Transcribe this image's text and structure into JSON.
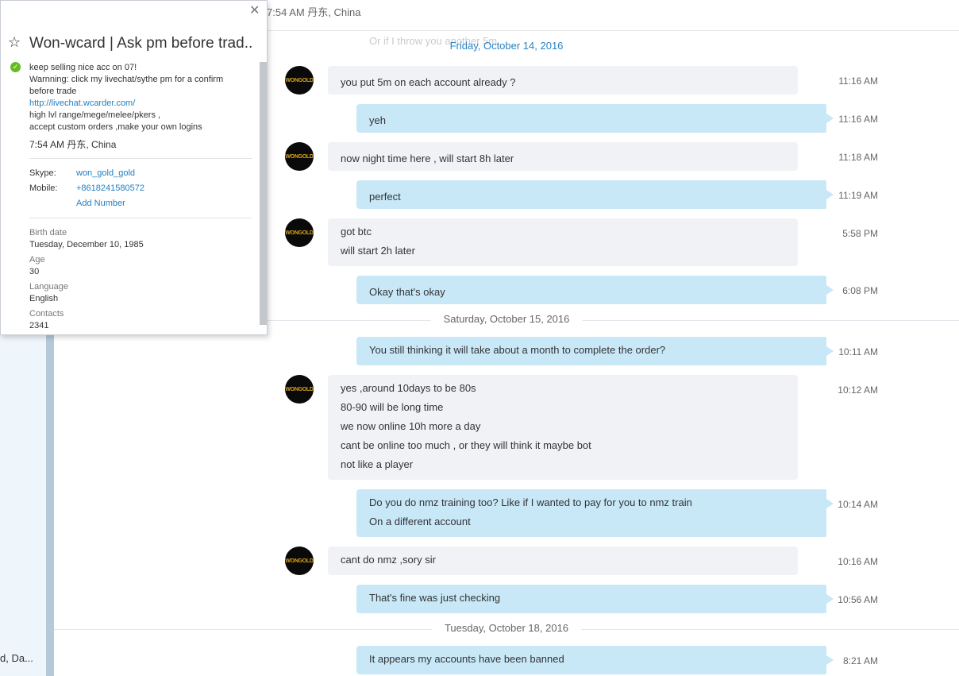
{
  "sidebar": {
    "truncated_text": "d, Da..."
  },
  "header": {
    "location": "7:54 AM 丹东, China"
  },
  "ghost_message": "Or if I throw you another 5m",
  "date_separators": [
    "Friday, October 14, 2016",
    "Saturday, October 15, 2016",
    "Tuesday, October 18, 2016"
  ],
  "avatar_text": "WONGOLD",
  "messages": [
    {
      "dir": "in",
      "lines": [
        "you put 5m on each account already  ?"
      ],
      "time": "11:16 AM"
    },
    {
      "dir": "out",
      "lines": [
        "yeh"
      ],
      "time": "11:16 AM"
    },
    {
      "dir": "in",
      "lines": [
        "now night time here , will start 8h later"
      ],
      "time": "11:18 AM"
    },
    {
      "dir": "out",
      "lines": [
        "perfect"
      ],
      "time": "11:19 AM"
    },
    {
      "dir": "in",
      "lines": [
        "got btc",
        "will start 2h later"
      ],
      "time": "5:58 PM"
    },
    {
      "dir": "out",
      "lines": [
        "Okay that's okay"
      ],
      "time": "6:08 PM"
    },
    {
      "dir": "out",
      "lines": [
        "You still thinking it will take about a month to complete the order?"
      ],
      "time": "10:11 AM"
    },
    {
      "dir": "in",
      "lines": [
        "yes  ,around 10days to be 80s",
        "80-90 will be long time",
        "we now online 10h more a day",
        "cant be online too much , or they will think it maybe bot",
        "not like a player"
      ],
      "time": "10:12 AM"
    },
    {
      "dir": "out",
      "lines": [
        "Do you do nmz training too? Like if I wanted to pay for you to nmz train",
        "On a different account"
      ],
      "time": "10:14 AM"
    },
    {
      "dir": "in",
      "lines": [
        "cant do nmz ,sory sir"
      ],
      "time": "10:16 AM"
    },
    {
      "dir": "out",
      "lines": [
        "That's fine was just checking"
      ],
      "time": "10:56 AM"
    },
    {
      "dir": "out",
      "lines": [
        "It appears my accounts have been banned"
      ],
      "time": "8:21 AM"
    }
  ],
  "profile": {
    "title": "Won-wcard | Ask pm before trad...",
    "status": "online",
    "mood_lines": [
      "keep selling nice acc on 07!",
      "Warnning: click my livechat/sythe pm for a confirm",
      "before trade",
      "http://livechat.wcarder.com/",
      "high lvl range/mege/melee/pkers ,",
      "accept custom orders ,make your own logins"
    ],
    "local_time": "7:54 AM 丹东, China",
    "skype_label": "Skype:",
    "skype_value": "won_gold_gold",
    "mobile_label": "Mobile:",
    "mobile_value": "+8618241580572",
    "add_number": "Add Number",
    "fields": [
      {
        "label": "Birth date",
        "value": "Tuesday, December 10, 1985"
      },
      {
        "label": "Age",
        "value": "30"
      },
      {
        "label": "Language",
        "value": "English"
      },
      {
        "label": "Contacts",
        "value": "2341"
      }
    ]
  }
}
